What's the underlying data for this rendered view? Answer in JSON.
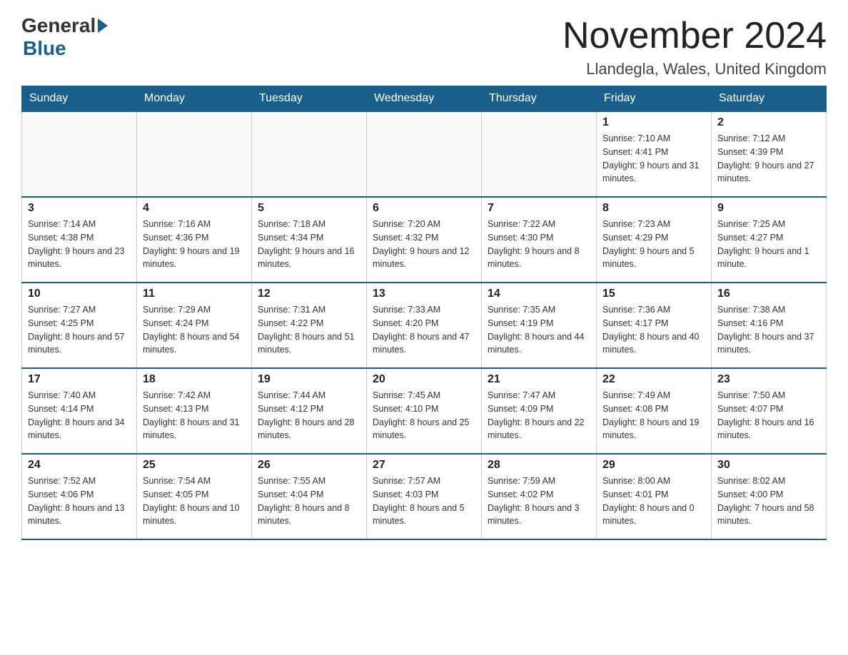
{
  "header": {
    "logo_general": "General",
    "logo_blue": "Blue",
    "month_title": "November 2024",
    "location": "Llandegla, Wales, United Kingdom"
  },
  "days_of_week": [
    "Sunday",
    "Monday",
    "Tuesday",
    "Wednesday",
    "Thursday",
    "Friday",
    "Saturday"
  ],
  "weeks": [
    [
      {
        "day": "",
        "sunrise": "",
        "sunset": "",
        "daylight": ""
      },
      {
        "day": "",
        "sunrise": "",
        "sunset": "",
        "daylight": ""
      },
      {
        "day": "",
        "sunrise": "",
        "sunset": "",
        "daylight": ""
      },
      {
        "day": "",
        "sunrise": "",
        "sunset": "",
        "daylight": ""
      },
      {
        "day": "",
        "sunrise": "",
        "sunset": "",
        "daylight": ""
      },
      {
        "day": "1",
        "sunrise": "Sunrise: 7:10 AM",
        "sunset": "Sunset: 4:41 PM",
        "daylight": "Daylight: 9 hours and 31 minutes."
      },
      {
        "day": "2",
        "sunrise": "Sunrise: 7:12 AM",
        "sunset": "Sunset: 4:39 PM",
        "daylight": "Daylight: 9 hours and 27 minutes."
      }
    ],
    [
      {
        "day": "3",
        "sunrise": "Sunrise: 7:14 AM",
        "sunset": "Sunset: 4:38 PM",
        "daylight": "Daylight: 9 hours and 23 minutes."
      },
      {
        "day": "4",
        "sunrise": "Sunrise: 7:16 AM",
        "sunset": "Sunset: 4:36 PM",
        "daylight": "Daylight: 9 hours and 19 minutes."
      },
      {
        "day": "5",
        "sunrise": "Sunrise: 7:18 AM",
        "sunset": "Sunset: 4:34 PM",
        "daylight": "Daylight: 9 hours and 16 minutes."
      },
      {
        "day": "6",
        "sunrise": "Sunrise: 7:20 AM",
        "sunset": "Sunset: 4:32 PM",
        "daylight": "Daylight: 9 hours and 12 minutes."
      },
      {
        "day": "7",
        "sunrise": "Sunrise: 7:22 AM",
        "sunset": "Sunset: 4:30 PM",
        "daylight": "Daylight: 9 hours and 8 minutes."
      },
      {
        "day": "8",
        "sunrise": "Sunrise: 7:23 AM",
        "sunset": "Sunset: 4:29 PM",
        "daylight": "Daylight: 9 hours and 5 minutes."
      },
      {
        "day": "9",
        "sunrise": "Sunrise: 7:25 AM",
        "sunset": "Sunset: 4:27 PM",
        "daylight": "Daylight: 9 hours and 1 minute."
      }
    ],
    [
      {
        "day": "10",
        "sunrise": "Sunrise: 7:27 AM",
        "sunset": "Sunset: 4:25 PM",
        "daylight": "Daylight: 8 hours and 57 minutes."
      },
      {
        "day": "11",
        "sunrise": "Sunrise: 7:29 AM",
        "sunset": "Sunset: 4:24 PM",
        "daylight": "Daylight: 8 hours and 54 minutes."
      },
      {
        "day": "12",
        "sunrise": "Sunrise: 7:31 AM",
        "sunset": "Sunset: 4:22 PM",
        "daylight": "Daylight: 8 hours and 51 minutes."
      },
      {
        "day": "13",
        "sunrise": "Sunrise: 7:33 AM",
        "sunset": "Sunset: 4:20 PM",
        "daylight": "Daylight: 8 hours and 47 minutes."
      },
      {
        "day": "14",
        "sunrise": "Sunrise: 7:35 AM",
        "sunset": "Sunset: 4:19 PM",
        "daylight": "Daylight: 8 hours and 44 minutes."
      },
      {
        "day": "15",
        "sunrise": "Sunrise: 7:36 AM",
        "sunset": "Sunset: 4:17 PM",
        "daylight": "Daylight: 8 hours and 40 minutes."
      },
      {
        "day": "16",
        "sunrise": "Sunrise: 7:38 AM",
        "sunset": "Sunset: 4:16 PM",
        "daylight": "Daylight: 8 hours and 37 minutes."
      }
    ],
    [
      {
        "day": "17",
        "sunrise": "Sunrise: 7:40 AM",
        "sunset": "Sunset: 4:14 PM",
        "daylight": "Daylight: 8 hours and 34 minutes."
      },
      {
        "day": "18",
        "sunrise": "Sunrise: 7:42 AM",
        "sunset": "Sunset: 4:13 PM",
        "daylight": "Daylight: 8 hours and 31 minutes."
      },
      {
        "day": "19",
        "sunrise": "Sunrise: 7:44 AM",
        "sunset": "Sunset: 4:12 PM",
        "daylight": "Daylight: 8 hours and 28 minutes."
      },
      {
        "day": "20",
        "sunrise": "Sunrise: 7:45 AM",
        "sunset": "Sunset: 4:10 PM",
        "daylight": "Daylight: 8 hours and 25 minutes."
      },
      {
        "day": "21",
        "sunrise": "Sunrise: 7:47 AM",
        "sunset": "Sunset: 4:09 PM",
        "daylight": "Daylight: 8 hours and 22 minutes."
      },
      {
        "day": "22",
        "sunrise": "Sunrise: 7:49 AM",
        "sunset": "Sunset: 4:08 PM",
        "daylight": "Daylight: 8 hours and 19 minutes."
      },
      {
        "day": "23",
        "sunrise": "Sunrise: 7:50 AM",
        "sunset": "Sunset: 4:07 PM",
        "daylight": "Daylight: 8 hours and 16 minutes."
      }
    ],
    [
      {
        "day": "24",
        "sunrise": "Sunrise: 7:52 AM",
        "sunset": "Sunset: 4:06 PM",
        "daylight": "Daylight: 8 hours and 13 minutes."
      },
      {
        "day": "25",
        "sunrise": "Sunrise: 7:54 AM",
        "sunset": "Sunset: 4:05 PM",
        "daylight": "Daylight: 8 hours and 10 minutes."
      },
      {
        "day": "26",
        "sunrise": "Sunrise: 7:55 AM",
        "sunset": "Sunset: 4:04 PM",
        "daylight": "Daylight: 8 hours and 8 minutes."
      },
      {
        "day": "27",
        "sunrise": "Sunrise: 7:57 AM",
        "sunset": "Sunset: 4:03 PM",
        "daylight": "Daylight: 8 hours and 5 minutes."
      },
      {
        "day": "28",
        "sunrise": "Sunrise: 7:59 AM",
        "sunset": "Sunset: 4:02 PM",
        "daylight": "Daylight: 8 hours and 3 minutes."
      },
      {
        "day": "29",
        "sunrise": "Sunrise: 8:00 AM",
        "sunset": "Sunset: 4:01 PM",
        "daylight": "Daylight: 8 hours and 0 minutes."
      },
      {
        "day": "30",
        "sunrise": "Sunrise: 8:02 AM",
        "sunset": "Sunset: 4:00 PM",
        "daylight": "Daylight: 7 hours and 58 minutes."
      }
    ]
  ]
}
